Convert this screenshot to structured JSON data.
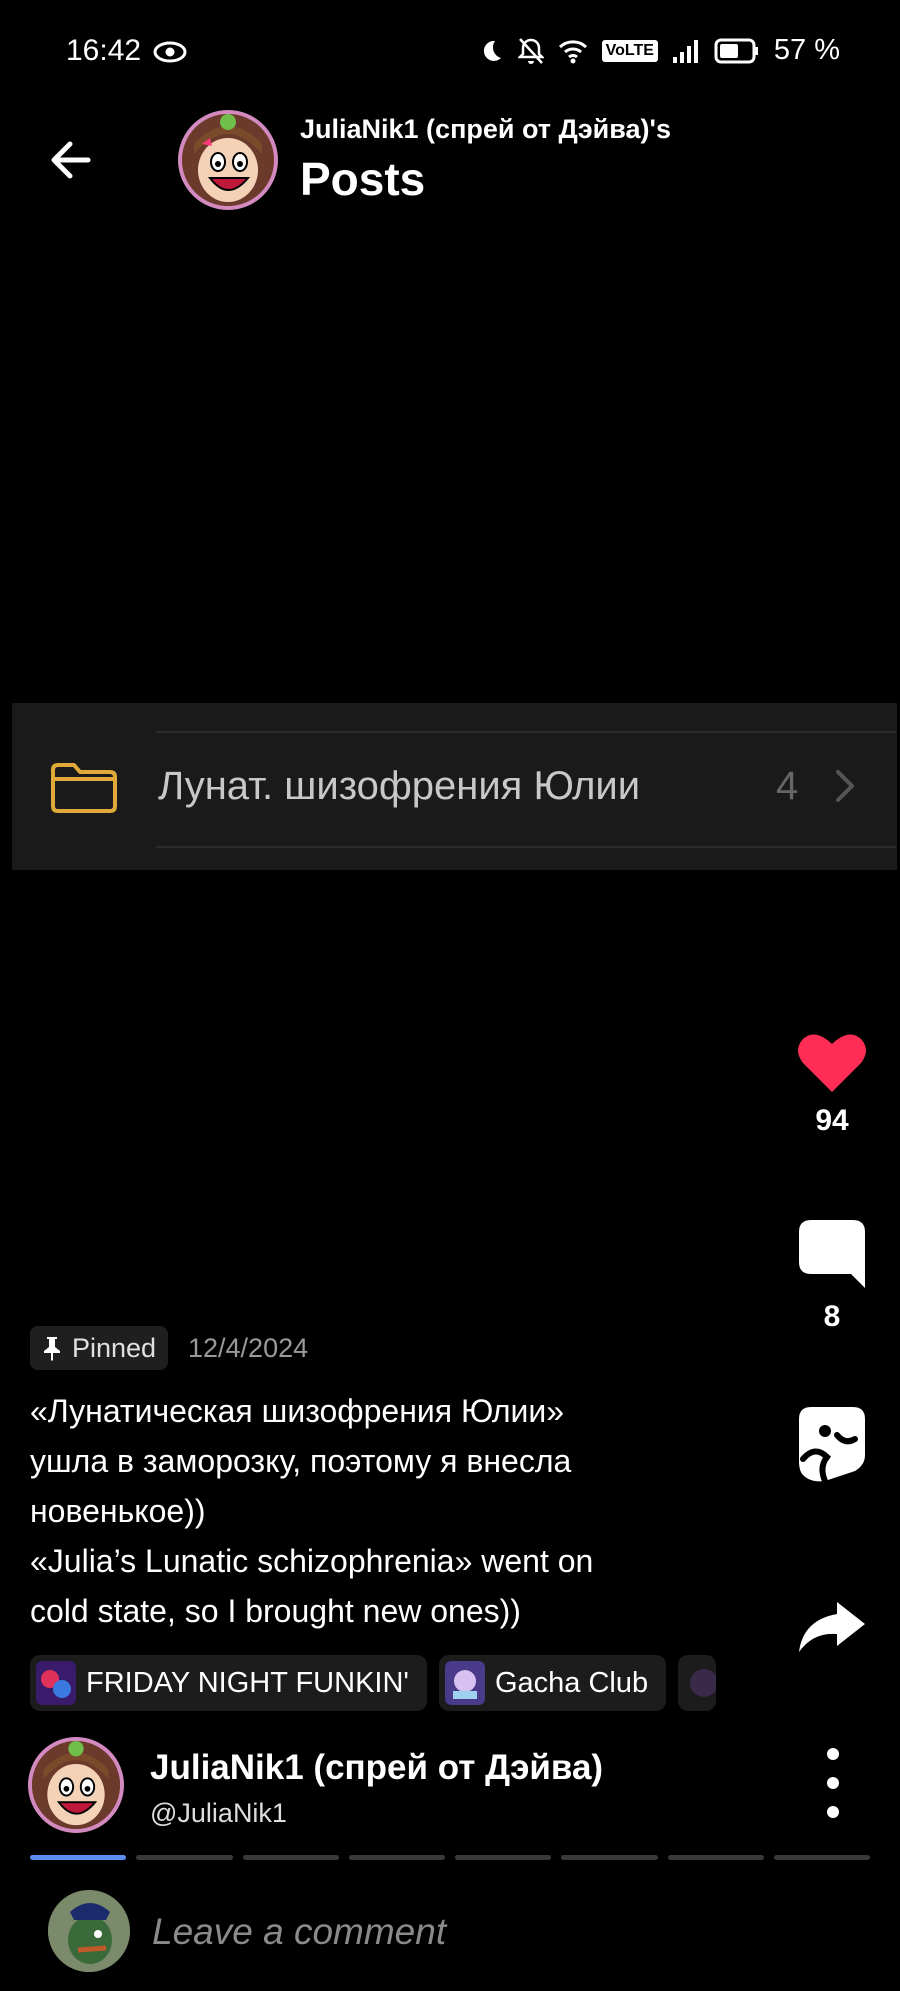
{
  "status_bar": {
    "time": "16:42",
    "network": "VoLTE",
    "battery": "57 %"
  },
  "header": {
    "subtitle": "JuliaNik1 (спрей от Дэйва)'s",
    "title": "Posts"
  },
  "folder": {
    "name": "Лунат. шизофрения Юлии",
    "count": "4",
    "accent_color": "#e0a93a"
  },
  "actions": {
    "like_count": "94",
    "comment_count": "8",
    "like_color": "#ff2d55"
  },
  "post": {
    "pinned_label": "Pinned",
    "date": "12/4/2024",
    "text": "«Лунатическая шизофрения Юлии»\nушла в заморозку, поэтому я внесла\nновенькое))\n«Julia’s Lunatic schizophrenia» went on\ncold state, so I brought new ones))",
    "tags": [
      "FRIDAY NIGHT FUNKIN'",
      "Gacha Club"
    ]
  },
  "author": {
    "name": "JuliaNik1 (спрей от Дэйва)",
    "handle": "@JuliaNik1"
  },
  "progress": {
    "segments": 8,
    "active_index": 0
  },
  "comment": {
    "placeholder": "Leave a comment"
  }
}
